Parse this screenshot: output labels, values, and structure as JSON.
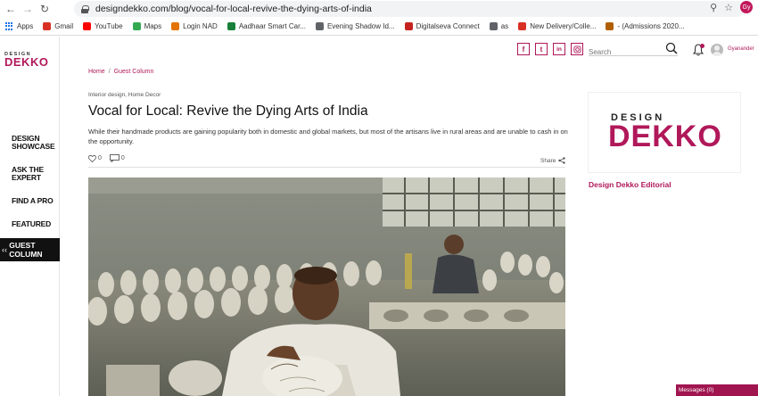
{
  "browser": {
    "url": "designdekko.com/blog/vocal-for-local-revive-the-dying-arts-of-india",
    "profile_initials": "Gy"
  },
  "bookmarks": [
    {
      "label": "Apps",
      "icon": "apps-grid-icon",
      "color": "#1a73e8"
    },
    {
      "label": "Gmail",
      "icon": "gmail-icon",
      "color": "#d93025"
    },
    {
      "label": "YouTube",
      "icon": "youtube-icon",
      "color": "#ff0000"
    },
    {
      "label": "Maps",
      "icon": "maps-icon",
      "color": "#34a853"
    },
    {
      "label": "Login NAD",
      "icon": "nad-icon",
      "color": "#e37400"
    },
    {
      "label": "Aadhaar Smart Car...",
      "icon": "aadhaar-icon",
      "color": "#188038"
    },
    {
      "label": "Evening Shadow Id...",
      "icon": "evening-shadow-icon",
      "color": "#5f6368"
    },
    {
      "label": "Digitalseva Connect",
      "icon": "digitalseva-icon",
      "color": "#c5221f"
    },
    {
      "label": "as",
      "icon": "globe-icon",
      "color": "#5f6368"
    },
    {
      "label": "New Delivery/Colle...",
      "icon": "gmail-icon",
      "color": "#d93025"
    },
    {
      "label": "- (Admissions 2020...",
      "icon": "admissions-icon",
      "color": "#b06000"
    }
  ],
  "site": {
    "logo_top": "DESIGN",
    "logo_main": "DEKKO",
    "brand_color": "#b0185a"
  },
  "sidebar": {
    "items": [
      "DESIGN SHOWCASE",
      "ASK THE EXPERT",
      "FIND A PRO",
      "FEATURED"
    ],
    "active": "GUEST COLUMN"
  },
  "header": {
    "social": [
      "f",
      "t",
      "in",
      "ig"
    ],
    "search_placeholder": "Search",
    "username": "Gyanander"
  },
  "article": {
    "breadcrumb": [
      "Home",
      "Guest Column"
    ],
    "categories": "Interior design, Home Decor",
    "title": "Vocal for Local: Revive the Dying Arts of India",
    "summary": "While their handmade products are gaining popularity both in domestic and global markets, but most of the artisans live in rural areas and are unable to cash in on the opportunity.",
    "likes": "0",
    "comments": "0",
    "share_label": "Share"
  },
  "author": {
    "name": "Design Dekko Editorial"
  },
  "messages_label": "Messages (0)"
}
